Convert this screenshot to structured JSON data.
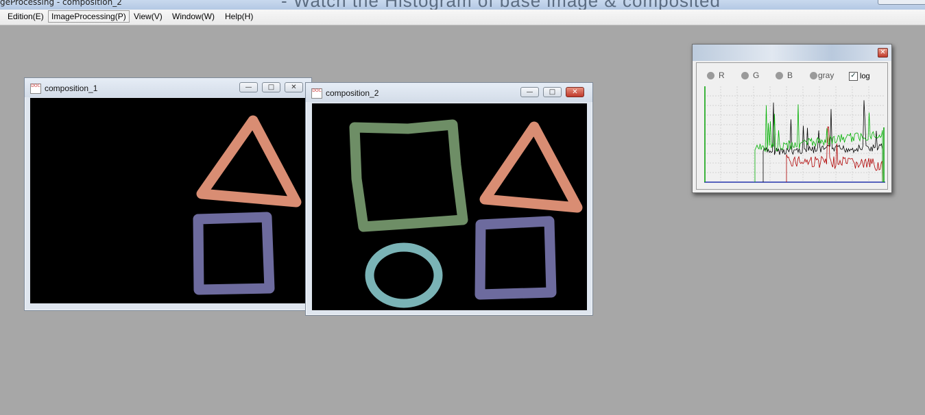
{
  "app": {
    "title": "geProcessing - composition_2",
    "background_text": "- Watch the Histogram of base image & composited"
  },
  "menu": {
    "items": [
      "Edition(E)",
      "ImageProcessing(P)",
      "View(V)",
      "Window(W)",
      "Help(H)"
    ],
    "active": "ImageProcessing(P)"
  },
  "windows": {
    "composition_1": {
      "title": "composition_1"
    },
    "composition_2": {
      "title": "composition_2"
    }
  },
  "shape_colors": {
    "triangle": "#d98d73",
    "square_blue": "#6d6b9e",
    "square_green": "#6e8e66",
    "circle": "#7ab3b6"
  },
  "histogram": {
    "radios": [
      "R",
      "G",
      "B",
      "gray"
    ],
    "log_label": "log",
    "log_checked": true,
    "series_colors": {
      "red": "#b00000",
      "green": "#00b000",
      "black": "#000000",
      "baseline": "#2233aa"
    }
  }
}
